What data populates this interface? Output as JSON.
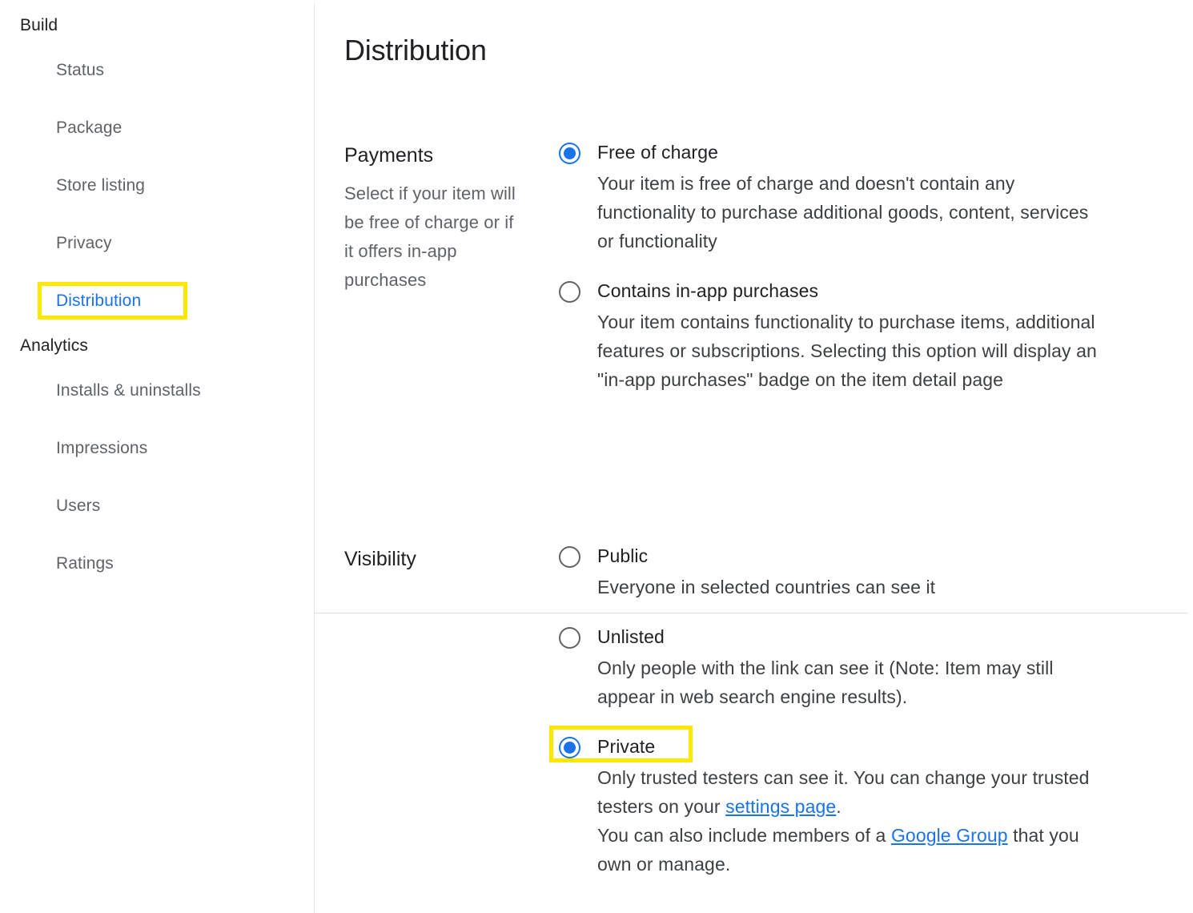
{
  "sidebar": {
    "groups": [
      {
        "title": "Build",
        "items": [
          {
            "label": "Status",
            "active": false
          },
          {
            "label": "Package",
            "active": false
          },
          {
            "label": "Store listing",
            "active": false
          },
          {
            "label": "Privacy",
            "active": false
          },
          {
            "label": "Distribution",
            "active": true
          }
        ]
      },
      {
        "title": "Analytics",
        "items": [
          {
            "label": "Installs & uninstalls",
            "active": false
          },
          {
            "label": "Impressions",
            "active": false
          },
          {
            "label": "Users",
            "active": false
          },
          {
            "label": "Ratings",
            "active": false
          }
        ]
      }
    ]
  },
  "main": {
    "title": "Distribution",
    "sections": {
      "payments": {
        "label": "Payments",
        "description": "Select if your item will be free of charge or if it offers in-app purchases",
        "options": [
          {
            "label": "Free of charge",
            "description": "Your item is free of charge and doesn't contain any functionality to purchase additional goods, content, services or functionality",
            "selected": true
          },
          {
            "label": "Contains in-app purchases",
            "description": "Your item contains functionality to purchase items, additional features or subscriptions. Selecting this option will display an \"in-app purchases\" badge on the item detail page",
            "selected": false
          }
        ]
      },
      "visibility": {
        "label": "Visibility",
        "description": "",
        "options": [
          {
            "label": "Public",
            "description": "Everyone in selected countries can see it",
            "selected": false
          },
          {
            "label": "Unlisted",
            "description": "Only people with the link can see it (Note: Item may still appear in web search engine results).",
            "selected": false
          },
          {
            "label": "Private",
            "description_part1": "Only trusted testers can see it. You can change your trusted testers on your ",
            "link1": "settings page",
            "description_part2": ".",
            "description_part3": "You can also include members of a ",
            "link2": "Google Group",
            "description_part4": " that you own or manage.",
            "selected": true
          }
        ]
      }
    }
  },
  "colors": {
    "accent_blue": "#1a73e8",
    "highlight_yellow": "#ffe800",
    "text_primary": "#202124",
    "text_secondary": "#5f6368",
    "divider": "#e0e0e0"
  }
}
